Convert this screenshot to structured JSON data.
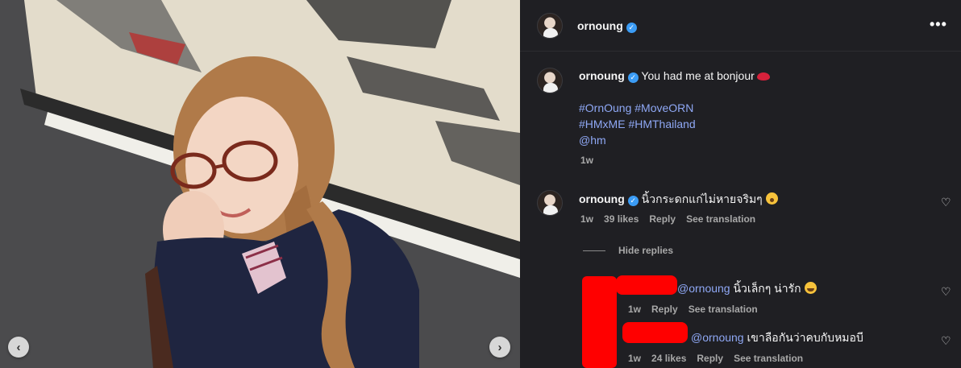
{
  "photo": {
    "alt_icons": {
      "prev": "chevron-left-icon",
      "next": "chevron-right-icon"
    },
    "prev_glyph": "‹",
    "next_glyph": "›"
  },
  "header": {
    "username": "ornoung",
    "more_glyph": "•••"
  },
  "caption": {
    "username": "ornoung",
    "text": "You had me at bonjour",
    "hashtags_line1": "#OrnOung #MoveORN",
    "hashtags_line2": "#HMxME #HMThailand",
    "mention": "@hm",
    "time": "1w"
  },
  "comment": {
    "username": "ornoung",
    "text": "นิ้วกระดกแก่ไม่หายจริมๆ",
    "time": "1w",
    "likes": "39 likes",
    "reply": "Reply",
    "translate": "See translation",
    "hide_replies": "Hide replies"
  },
  "replies": [
    {
      "mention": "@ornoung",
      "text": "นิ้วเล็กๆ น่ารัก",
      "time": "1w",
      "reply": "Reply",
      "translate": "See translation"
    },
    {
      "mention": "@ornoung",
      "text": "เขาลือกันว่าคบกับหมอบี",
      "time": "1w",
      "likes": "24 likes",
      "reply": "Reply",
      "translate": "See translation"
    }
  ],
  "icons": {
    "verified": "verified-badge-icon",
    "heart": "heart-icon",
    "verified_glyph": "✓",
    "heart_glyph": "♡"
  },
  "colors": {
    "panel_bg": "#1f1f23",
    "link": "#8fa8f5",
    "verified": "#3b9cf5",
    "redaction": "#ff0000"
  }
}
